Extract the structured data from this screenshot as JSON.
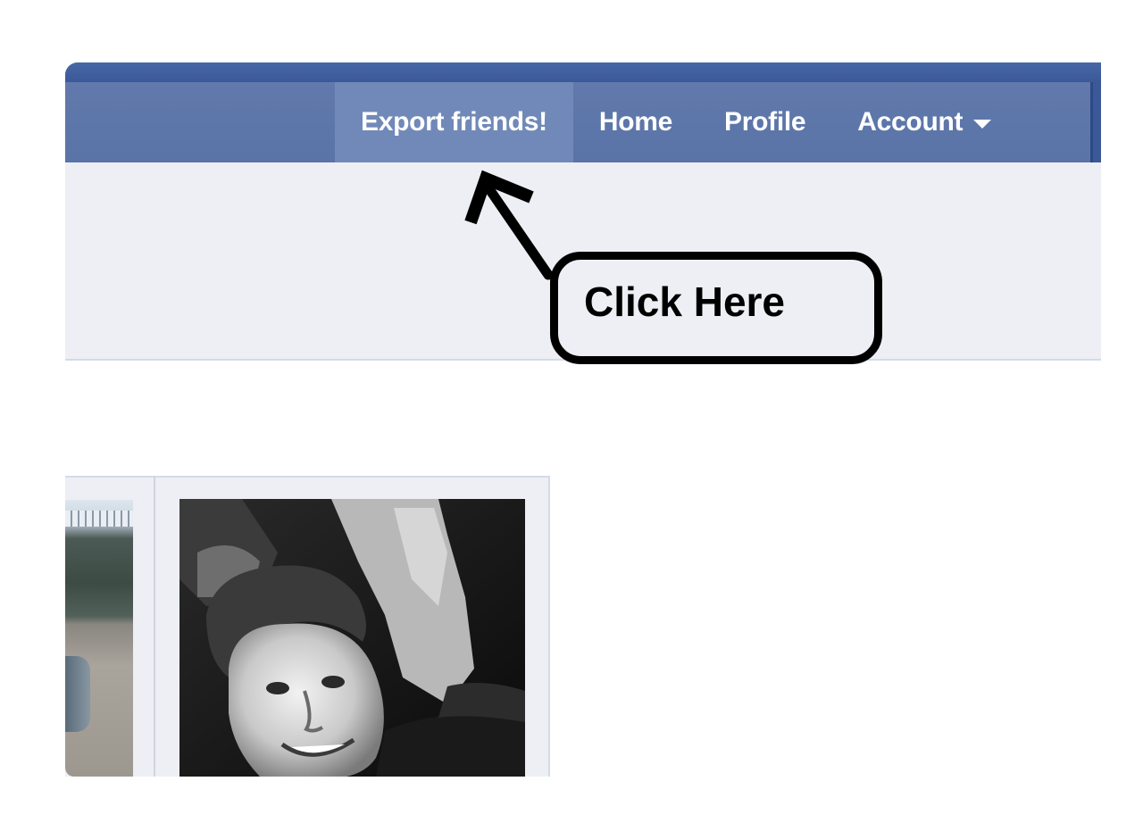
{
  "nav": {
    "items": [
      {
        "label": "Export friends!"
      },
      {
        "label": "Home"
      },
      {
        "label": "Profile"
      },
      {
        "label": "Account"
      }
    ]
  },
  "callout": {
    "text": "Click Here"
  },
  "colors": {
    "bar_dark": "#3b5998",
    "bar_light": "#6179ab",
    "nav_active": "#7189b8",
    "subarea": "#edeff4"
  },
  "icons": {
    "dropdown": "chevron-down-icon",
    "pointer": "arrow-icon"
  }
}
